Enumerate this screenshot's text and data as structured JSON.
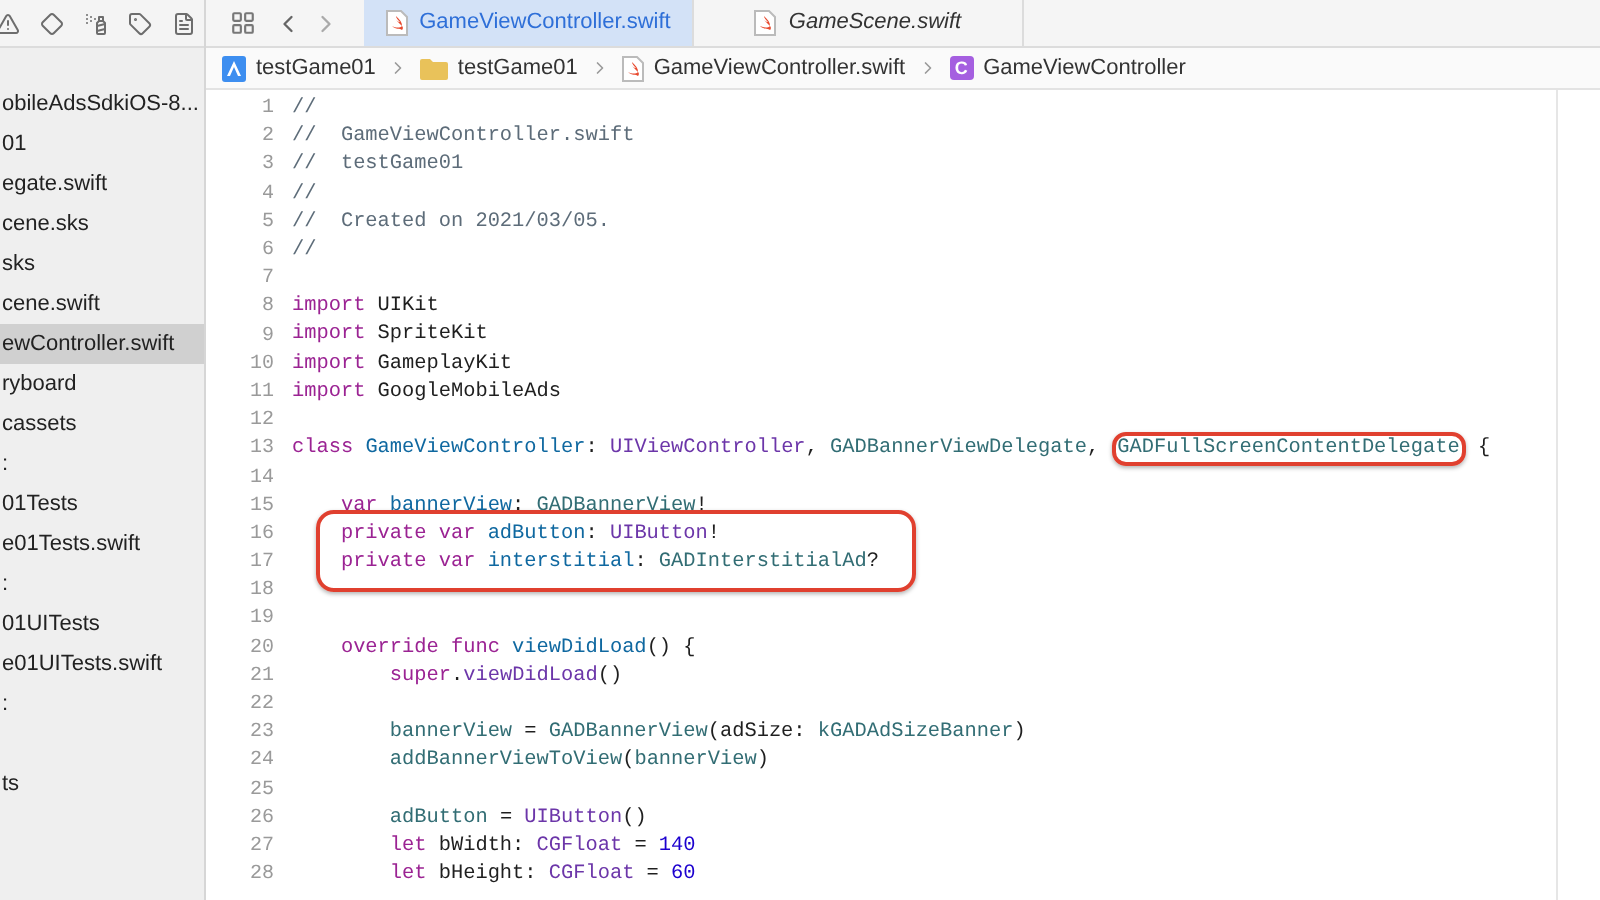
{
  "tabs": [
    {
      "label": "GameViewController.swift",
      "selected": true,
      "preview": false
    },
    {
      "label": "GameScene.swift",
      "selected": false,
      "preview": true
    }
  ],
  "breadcrumb": [
    {
      "kind": "project",
      "label": "testGame01"
    },
    {
      "kind": "folder",
      "label": "testGame01"
    },
    {
      "kind": "file",
      "label": "GameViewController.swift"
    },
    {
      "kind": "class",
      "badge": "C",
      "label": "GameViewController"
    }
  ],
  "sidebar": {
    "items": [
      {
        "label": "obileAdsSdkiOS-8...",
        "selected": false,
        "after_gap": false
      },
      {
        "label": "01",
        "selected": false,
        "after_gap": false
      },
      {
        "label": "egate.swift",
        "selected": false,
        "after_gap": false
      },
      {
        "label": "cene.sks",
        "selected": false,
        "after_gap": false
      },
      {
        "label": "sks",
        "selected": false,
        "after_gap": false
      },
      {
        "label": "cene.swift",
        "selected": false,
        "after_gap": false
      },
      {
        "label": "ewController.swift",
        "selected": true,
        "after_gap": false
      },
      {
        "label": "ryboard",
        "selected": false,
        "after_gap": false
      },
      {
        "label": "cassets",
        "selected": false,
        "after_gap": false
      },
      {
        "label": ":",
        "selected": false,
        "after_gap": false
      },
      {
        "label": "01Tests",
        "selected": false,
        "after_gap": false
      },
      {
        "label": "e01Tests.swift",
        "selected": false,
        "after_gap": false
      },
      {
        "label": ":",
        "selected": false,
        "after_gap": false
      },
      {
        "label": "01UITests",
        "selected": false,
        "after_gap": false
      },
      {
        "label": "e01UITests.swift",
        "selected": false,
        "after_gap": false
      },
      {
        "label": ":",
        "selected": false,
        "after_gap": false
      },
      {
        "label": "ts",
        "selected": false,
        "after_gap": true
      }
    ]
  },
  "editor": {
    "lines": [
      {
        "number": "1",
        "boxed": false,
        "tokens": [
          {
            "kind": "comment",
            "text": "//"
          }
        ]
      },
      {
        "number": "2",
        "boxed": false,
        "tokens": [
          {
            "kind": "comment",
            "text": "//  GameViewController.swift"
          }
        ]
      },
      {
        "number": "3",
        "boxed": false,
        "tokens": [
          {
            "kind": "comment",
            "text": "//  testGame01"
          }
        ]
      },
      {
        "number": "4",
        "boxed": false,
        "tokens": [
          {
            "kind": "comment",
            "text": "//"
          }
        ]
      },
      {
        "number": "5",
        "boxed": false,
        "tokens": [
          {
            "kind": "comment",
            "text": "//  Created on 2021/03/05."
          }
        ]
      },
      {
        "number": "6",
        "boxed": false,
        "tokens": [
          {
            "kind": "comment",
            "text": "//"
          }
        ]
      },
      {
        "number": "7",
        "boxed": false
      },
      {
        "number": "8",
        "boxed": false,
        "tokens": [
          {
            "kind": "keyword",
            "text": "import"
          },
          {
            "kind": "plain",
            "text": " UIKit"
          }
        ]
      },
      {
        "number": "9",
        "boxed": false,
        "tokens": [
          {
            "kind": "keyword",
            "text": "import"
          },
          {
            "kind": "plain",
            "text": " SpriteKit"
          }
        ]
      },
      {
        "number": "10",
        "boxed": false,
        "tokens": [
          {
            "kind": "keyword",
            "text": "import"
          },
          {
            "kind": "plain",
            "text": " GameplayKit"
          }
        ]
      },
      {
        "number": "11",
        "boxed": false,
        "tokens": [
          {
            "kind": "keyword",
            "text": "import"
          },
          {
            "kind": "plain",
            "text": " GoogleMobileAds"
          }
        ]
      },
      {
        "number": "12",
        "boxed": false
      },
      {
        "number": "13",
        "boxed": false,
        "tokens": [
          {
            "kind": "keyword",
            "text": "class"
          },
          {
            "kind": "decl",
            "text": " GameViewController"
          },
          {
            "kind": "plain",
            "text": ": "
          },
          {
            "kind": "system",
            "text": "UIViewController"
          },
          {
            "kind": "plain",
            "text": ", "
          },
          {
            "kind": "project",
            "text": "GADBannerViewDelegate"
          },
          {
            "kind": "plain",
            "text": ", "
          },
          {
            "kind": "project",
            "text": "GADFullScreenContentDelegate",
            "circled": true
          },
          {
            "kind": "plain",
            "text": " {"
          }
        ]
      },
      {
        "number": "14",
        "boxed": false
      },
      {
        "number": "15",
        "boxed": false,
        "tokens": [
          {
            "kind": "keyword",
            "text": "    var"
          },
          {
            "kind": "decl",
            "text": " bannerView"
          },
          {
            "kind": "plain",
            "text": ": "
          },
          {
            "kind": "project",
            "text": "GADBannerView"
          },
          {
            "kind": "plain",
            "text": "!"
          }
        ]
      },
      {
        "number": "16",
        "boxed": true,
        "tokens": [
          {
            "kind": "keyword",
            "text": "    private var"
          },
          {
            "kind": "decl",
            "text": " adButton"
          },
          {
            "kind": "plain",
            "text": ": "
          },
          {
            "kind": "system",
            "text": "UIButton"
          },
          {
            "kind": "plain",
            "text": "!"
          }
        ]
      },
      {
        "number": "17",
        "boxed": true,
        "tokens": [
          {
            "kind": "keyword",
            "text": "    private var"
          },
          {
            "kind": "decl",
            "text": " interstitial"
          },
          {
            "kind": "plain",
            "text": ": "
          },
          {
            "kind": "project",
            "text": "GADInterstitialAd"
          },
          {
            "kind": "plain",
            "text": "?"
          }
        ]
      },
      {
        "number": "18",
        "boxed": false
      },
      {
        "number": "19",
        "boxed": false
      },
      {
        "number": "20",
        "boxed": false,
        "tokens": [
          {
            "kind": "keyword",
            "text": "    override func"
          },
          {
            "kind": "decl",
            "text": " viewDidLoad"
          },
          {
            "kind": "plain",
            "text": "() {"
          }
        ]
      },
      {
        "number": "21",
        "boxed": false,
        "tokens": [
          {
            "kind": "keyword",
            "text": "        super"
          },
          {
            "kind": "plain",
            "text": "."
          },
          {
            "kind": "system",
            "text": "viewDidLoad"
          },
          {
            "kind": "plain",
            "text": "()"
          }
        ]
      },
      {
        "number": "22",
        "boxed": false
      },
      {
        "number": "23",
        "boxed": false,
        "tokens": [
          {
            "kind": "project",
            "text": "        bannerView"
          },
          {
            "kind": "plain",
            "text": " = "
          },
          {
            "kind": "project",
            "text": "GADBannerView"
          },
          {
            "kind": "plain",
            "text": "(adSize: "
          },
          {
            "kind": "project",
            "text": "kGADAdSizeBanner"
          },
          {
            "kind": "plain",
            "text": ")"
          }
        ]
      },
      {
        "number": "24",
        "boxed": false,
        "tokens": [
          {
            "kind": "project",
            "text": "        addBannerViewToView"
          },
          {
            "kind": "plain",
            "text": "("
          },
          {
            "kind": "project",
            "text": "bannerView"
          },
          {
            "kind": "plain",
            "text": ")"
          }
        ]
      },
      {
        "number": "25",
        "boxed": false
      },
      {
        "number": "26",
        "boxed": false,
        "tokens": [
          {
            "kind": "project",
            "text": "        adButton"
          },
          {
            "kind": "plain",
            "text": " = "
          },
          {
            "kind": "system",
            "text": "UIButton"
          },
          {
            "kind": "plain",
            "text": "()"
          }
        ]
      },
      {
        "number": "27",
        "boxed": false,
        "tokens": [
          {
            "kind": "keyword",
            "text": "        let"
          },
          {
            "kind": "plain",
            "text": " bWidth: "
          },
          {
            "kind": "system",
            "text": "CGFloat"
          },
          {
            "kind": "plain",
            "text": " = "
          },
          {
            "kind": "number",
            "text": "140"
          }
        ]
      },
      {
        "number": "28",
        "boxed": false,
        "tokens": [
          {
            "kind": "keyword",
            "text": "        let"
          },
          {
            "kind": "plain",
            "text": " bHeight: "
          },
          {
            "kind": "system",
            "text": "CGFloat"
          },
          {
            "kind": "plain",
            "text": " = "
          },
          {
            "kind": "number",
            "text": "60"
          }
        ]
      }
    ]
  }
}
